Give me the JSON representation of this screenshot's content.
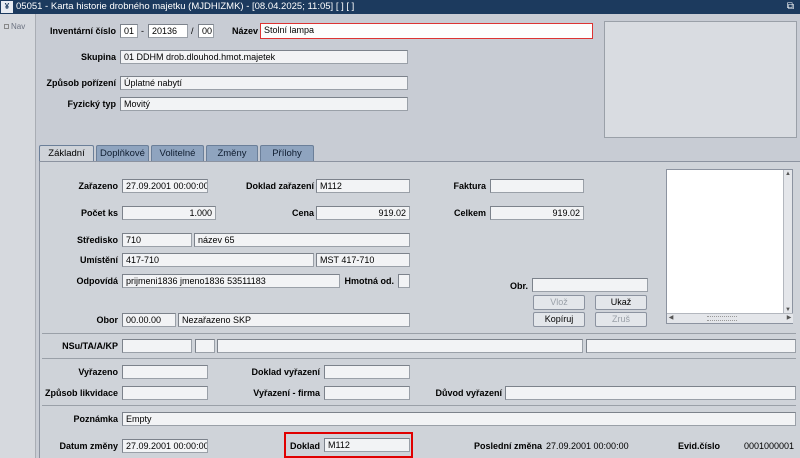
{
  "window": {
    "icon": "app-logo-icon",
    "title": "05051 - Karta historie drobného majetku (MJDHIZMK) - [08.04.2025; 11:05]  [ ]  [ ]",
    "restore_glyph": "⧉"
  },
  "nav": {
    "label": "Nav"
  },
  "header": {
    "inventarni_cislo": {
      "label": "Inventární číslo",
      "part1": "01",
      "part2": "20136",
      "part3": "00",
      "sep1": "-",
      "sep2": "/"
    },
    "nazev": {
      "label": "Název",
      "value": "Stolní lampa"
    },
    "skupina": {
      "label": "Skupina",
      "code": "01",
      "value": "DDHM drob.dlouhod.hmot.majetek"
    },
    "zpusob_porizeni": {
      "label": "Způsob pořízení",
      "value": "Úplatné nabytí"
    },
    "fyzicky_typ": {
      "label": "Fyzický typ",
      "value": "Movitý"
    }
  },
  "tabs": [
    {
      "label": "Základní",
      "active": true
    },
    {
      "label": "Doplňkové",
      "active": false
    },
    {
      "label": "Volitelné",
      "active": false
    },
    {
      "label": "Změny",
      "active": false
    },
    {
      "label": "Přílohy",
      "active": false
    }
  ],
  "basic": {
    "zarazeno": {
      "label": "Zařazeno",
      "value": "27.09.2001 00:00:00"
    },
    "doklad_zarazeni": {
      "label": "Doklad zařazení",
      "value": "M112"
    },
    "faktura": {
      "label": "Faktura",
      "value": ""
    },
    "pocet_ks": {
      "label": "Počet ks",
      "value": "1.000"
    },
    "cena": {
      "label": "Cena",
      "value": "919.02"
    },
    "celkem": {
      "label": "Celkem",
      "value": "919.02"
    },
    "stredisko": {
      "label": "Středisko",
      "code": "710",
      "value": "název 65"
    },
    "umisteni": {
      "label": "Umístění",
      "code": "417-710",
      "value": "MST 417-710"
    },
    "odpovida": {
      "label": "Odpovídá",
      "value": "prijmeni1836 jmeno1836 53511183"
    },
    "hmotna_od": {
      "label": "Hmotná od.",
      "value": ""
    },
    "obr": {
      "label": "Obr.",
      "value": ""
    },
    "buttons": {
      "vloz": "Vlož",
      "ukaz": "Ukaž",
      "kopiruj": "Kopíruj",
      "zrus": "Zruš"
    },
    "obor": {
      "label": "Obor",
      "code": "00.00.00",
      "value": "Nezařazeno SKP"
    },
    "nsu": {
      "label": "NSu/TA/A/KP"
    },
    "vyrazeno": {
      "label": "Vyřazeno",
      "value": ""
    },
    "doklad_vyrazeni": {
      "label": "Doklad vyřazení",
      "value": ""
    },
    "zpusob_likvidace": {
      "label": "Způsob likvidace",
      "value": ""
    },
    "vyrazeni_firma": {
      "label": "Vyřazení - firma",
      "value": ""
    },
    "duvod_vyrazeni": {
      "label": "Důvod vyřazení",
      "value": ""
    },
    "poznamka": {
      "label": "Poznámka",
      "value": "Empty"
    },
    "datum_zmeny": {
      "label": "Datum změny",
      "value": "27.09.2001 00:00:00"
    },
    "doklad": {
      "label": "Doklad",
      "value": "M112"
    },
    "posledni_zmena": {
      "label": "Poslední změna",
      "value": "27.09.2001 00:00:00"
    },
    "evid_cislo": {
      "label": "Evid.číslo",
      "value": "0001000001"
    }
  },
  "colors": {
    "titlebar": "#1c3a5e",
    "tab_inactive": "#8fa4bf",
    "highlight": "#e00000"
  }
}
